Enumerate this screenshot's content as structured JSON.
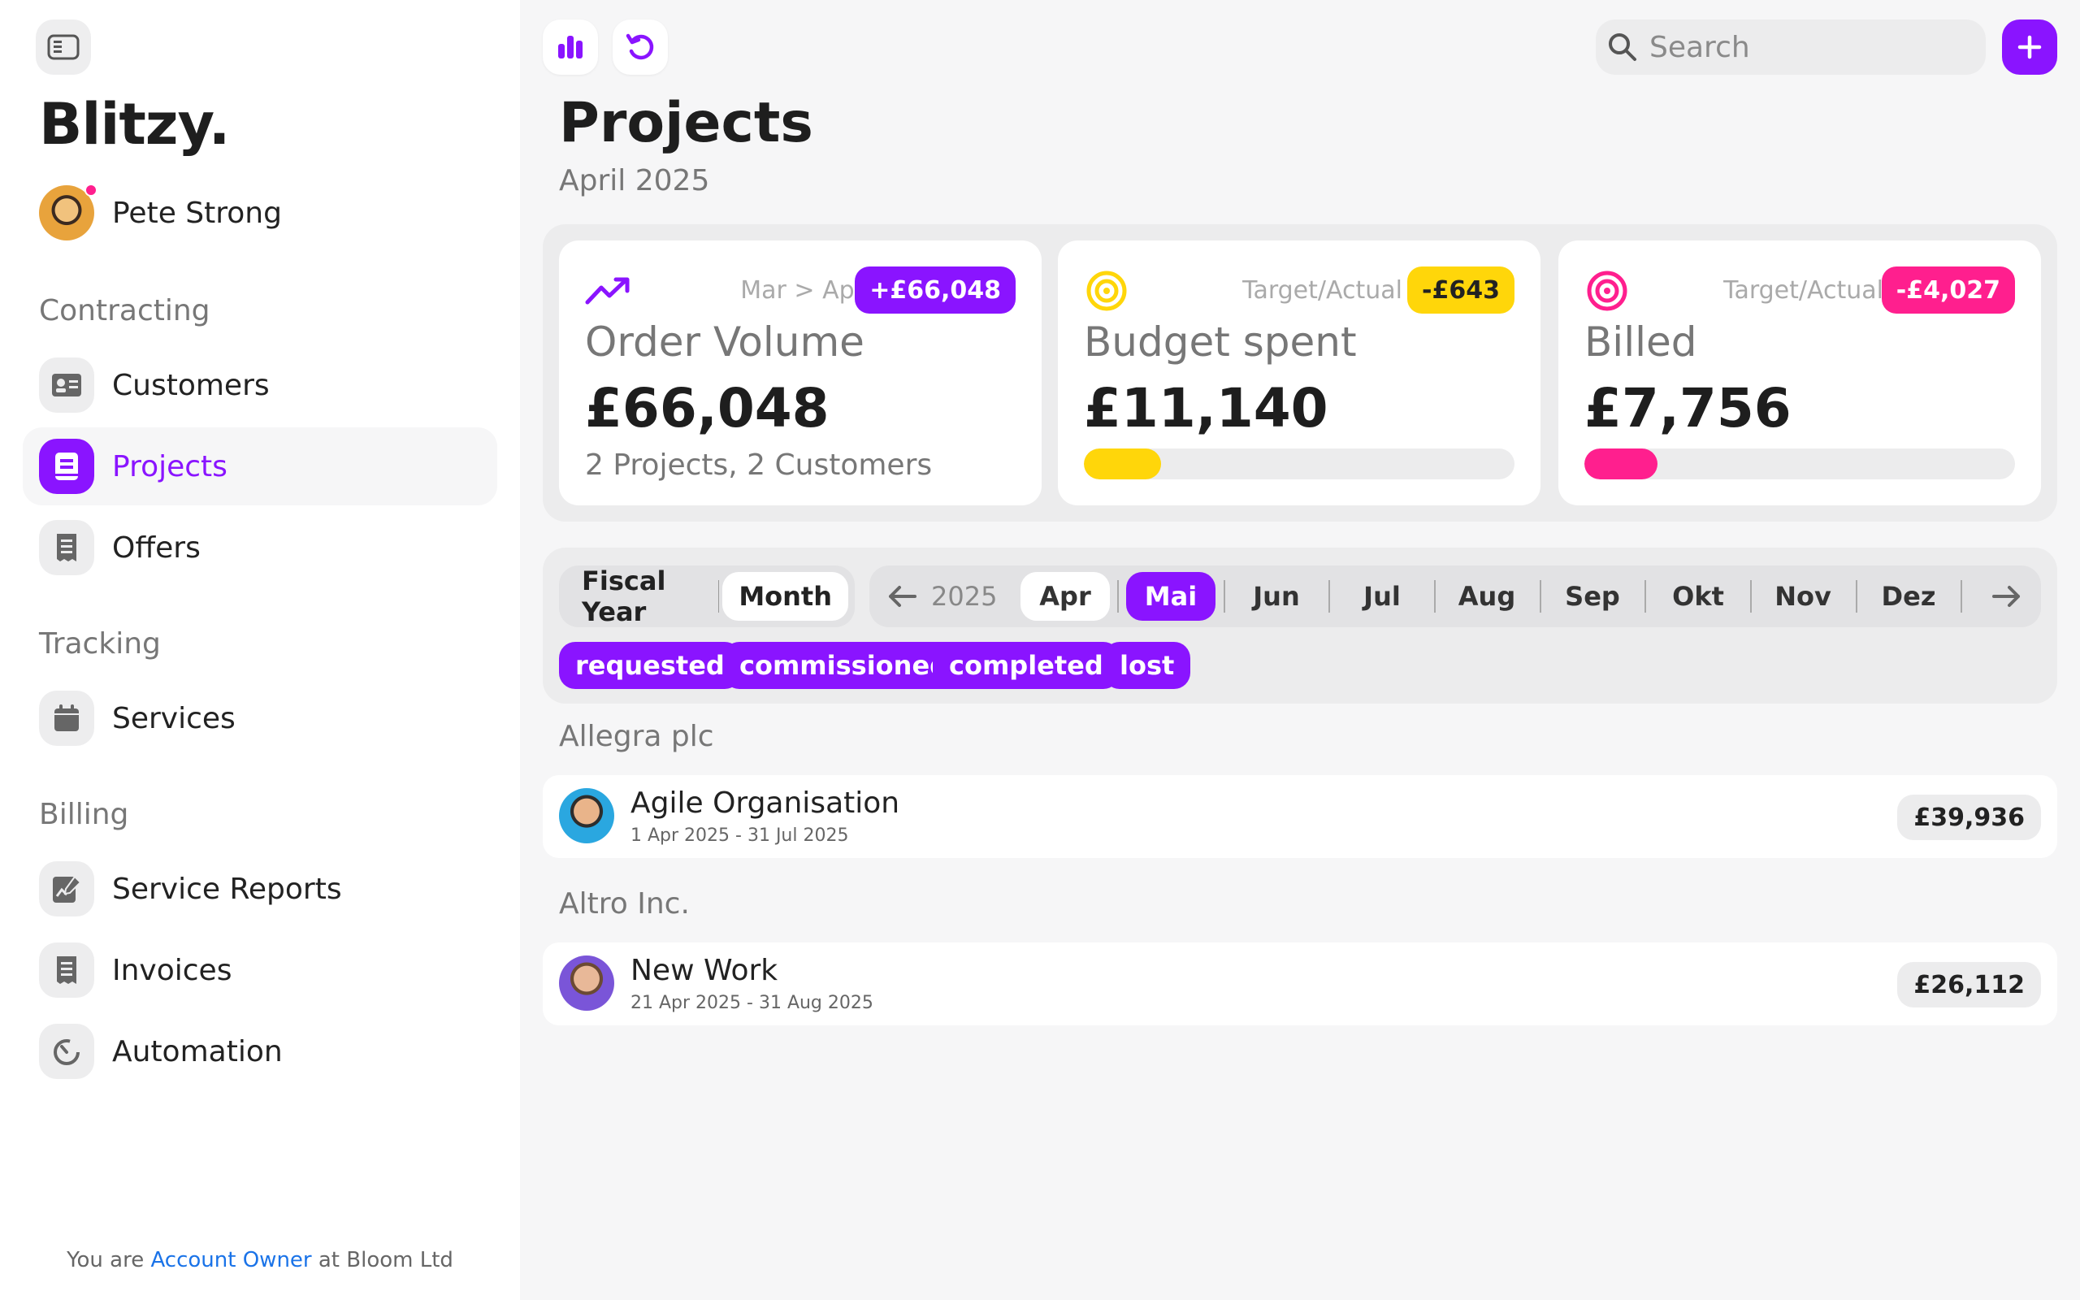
{
  "app": {
    "brand": "Blitzy.",
    "user_name": "Pete Strong"
  },
  "sidebar": {
    "sections": [
      {
        "title": "Contracting",
        "items": [
          {
            "label": "Customers",
            "icon": "contact-card-icon"
          },
          {
            "label": "Projects",
            "icon": "project-book-icon",
            "active": true
          },
          {
            "label": "Offers",
            "icon": "receipt-icon"
          }
        ]
      },
      {
        "title": "Tracking",
        "items": [
          {
            "label": "Services",
            "icon": "calendar-icon"
          }
        ]
      },
      {
        "title": "Billing",
        "items": [
          {
            "label": "Service Reports",
            "icon": "report-edit-icon"
          },
          {
            "label": "Invoices",
            "icon": "receipt-icon"
          },
          {
            "label": "Automation",
            "icon": "timer-icon"
          }
        ]
      }
    ],
    "footer": {
      "prefix": "You are",
      "role": "Account Owner",
      "suffix": "at Bloom Ltd"
    }
  },
  "topbar": {
    "search_placeholder": "Search"
  },
  "page": {
    "title": "Projects",
    "subtitle": "April 2025"
  },
  "cards": [
    {
      "title": "Order Volume",
      "meta": "Mar > Apr",
      "badge": "+£66,048",
      "value": "£66,048",
      "note": "2 Projects, 2 Customers",
      "color": "#8a14ff",
      "icon": "trend-up-icon"
    },
    {
      "title": "Budget spent",
      "meta": "Target/Actual",
      "badge": "-£643",
      "value": "£11,140",
      "progress": 0.18,
      "color": "#ffd60a",
      "icon": "target-icon"
    },
    {
      "title": "Billed",
      "meta": "Target/Actual",
      "badge": "-£4,027",
      "value": "£7,756",
      "progress": 0.17,
      "color": "#ff1f8e",
      "icon": "target-icon"
    }
  ],
  "filters": {
    "period_modes": [
      "Fiscal Year",
      "Month"
    ],
    "active_mode": "Month",
    "year": "2025",
    "months": [
      "Apr",
      "Mai",
      "Jun",
      "Jul",
      "Aug",
      "Sep",
      "Okt",
      "Nov",
      "Dez"
    ],
    "selected_month": "Mai",
    "statuses": [
      "requested",
      "commissioned",
      "completed",
      "lost"
    ]
  },
  "groups": [
    {
      "customer": "Allegra plc",
      "projects": [
        {
          "name": "Agile Organisation",
          "dates": "1 Apr 2025 - 31 Jul 2025",
          "amount": "£39,936"
        }
      ]
    },
    {
      "customer": "Altro Inc.",
      "projects": [
        {
          "name": "New Work",
          "dates": "21 Apr 2025 - 31 Aug 2025",
          "amount": "£26,112"
        }
      ]
    }
  ],
  "colors": {
    "accent": "#8a14ff",
    "yellow": "#ffd60a",
    "pink": "#ff1f8e"
  }
}
